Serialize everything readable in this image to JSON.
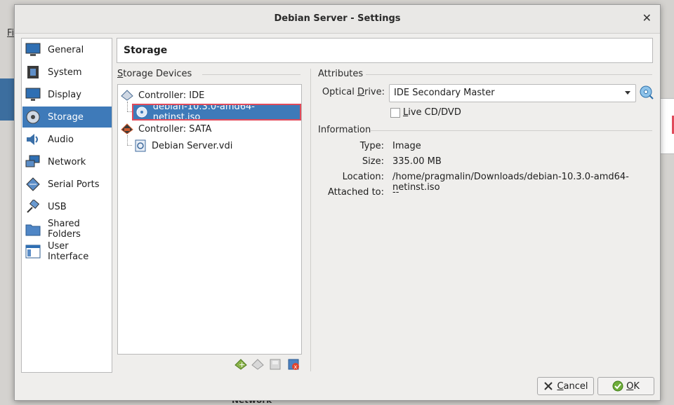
{
  "background": {
    "menu_stub": "Fi",
    "bottom_label": "Network"
  },
  "window": {
    "title": "Debian Server - Settings",
    "close_glyph": "✕"
  },
  "categories": [
    {
      "label": "General",
      "icon": "monitor-icon"
    },
    {
      "label": "System",
      "icon": "chip-icon"
    },
    {
      "label": "Display",
      "icon": "display-icon"
    },
    {
      "label": "Storage",
      "icon": "disk-icon",
      "selected": true
    },
    {
      "label": "Audio",
      "icon": "speaker-icon"
    },
    {
      "label": "Network",
      "icon": "network-icon"
    },
    {
      "label": "Serial Ports",
      "icon": "serial-icon"
    },
    {
      "label": "USB",
      "icon": "usb-icon"
    },
    {
      "label": "Shared Folders",
      "icon": "folder-icon"
    },
    {
      "label": "User Interface",
      "icon": "window-icon"
    }
  ],
  "page_title": "Storage",
  "storage": {
    "section_label": "Storage Devices",
    "tree": {
      "ide_controller": "Controller: IDE",
      "ide_item": "debian-10.3.0-amd64-netinst.iso",
      "sata_controller": "Controller: SATA",
      "sata_item": "Debian Server.vdi"
    }
  },
  "attributes": {
    "section_label": "Attributes",
    "optical_drive_label": "Optical Drive:",
    "optical_drive_value": "IDE Secondary Master",
    "live_cd_label": "Live CD/DVD",
    "live_cd_checked": false
  },
  "information": {
    "section_label": "Information",
    "type_label": "Type:",
    "type_value": "Image",
    "size_label": "Size:",
    "size_value": "335.00 MB",
    "location_label": "Location:",
    "location_value": "/home/pragmalin/Downloads/debian-10.3.0-amd64-netinst.iso",
    "attached_label": "Attached to:",
    "attached_value": "--"
  },
  "buttons": {
    "cancel": "Cancel",
    "ok": "OK"
  },
  "colors": {
    "selection": "#3e7ab9",
    "highlight_border": "#e04a5a"
  }
}
